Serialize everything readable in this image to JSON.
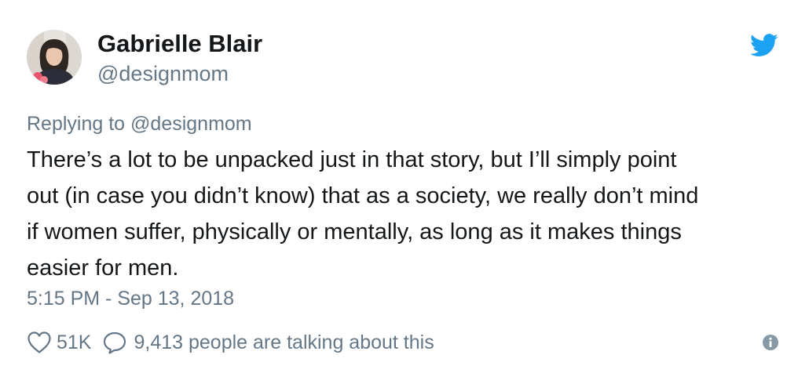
{
  "author": {
    "display_name": "Gabrielle Blair",
    "handle": "@designmom",
    "avatar_icon": "author-avatar"
  },
  "header": {
    "brand_icon": "twitter-bird-icon",
    "brand_color": "#1da1f2"
  },
  "reply": {
    "prefix": "Replying to",
    "target": "@designmom"
  },
  "tweet": {
    "lines": [
      "There’s a lot to be unpacked just in that story, but I’ll simply point",
      "out (in case you didn’t know) that as a society, we really don’t mind",
      "if women suffer, physically or mentally, as long as it makes things",
      "easier for men."
    ],
    "timestamp": "5:15 PM - Sep 13, 2018"
  },
  "actions": {
    "like_icon": "heart-icon",
    "like_count": "51K",
    "conversation_icon": "speech-bubble-icon",
    "conversation_text": "9,413 people are talking about this",
    "info_icon": "info-icon"
  },
  "colors": {
    "text": "#14171a",
    "secondary": "#657786",
    "brand": "#1da1f2"
  }
}
